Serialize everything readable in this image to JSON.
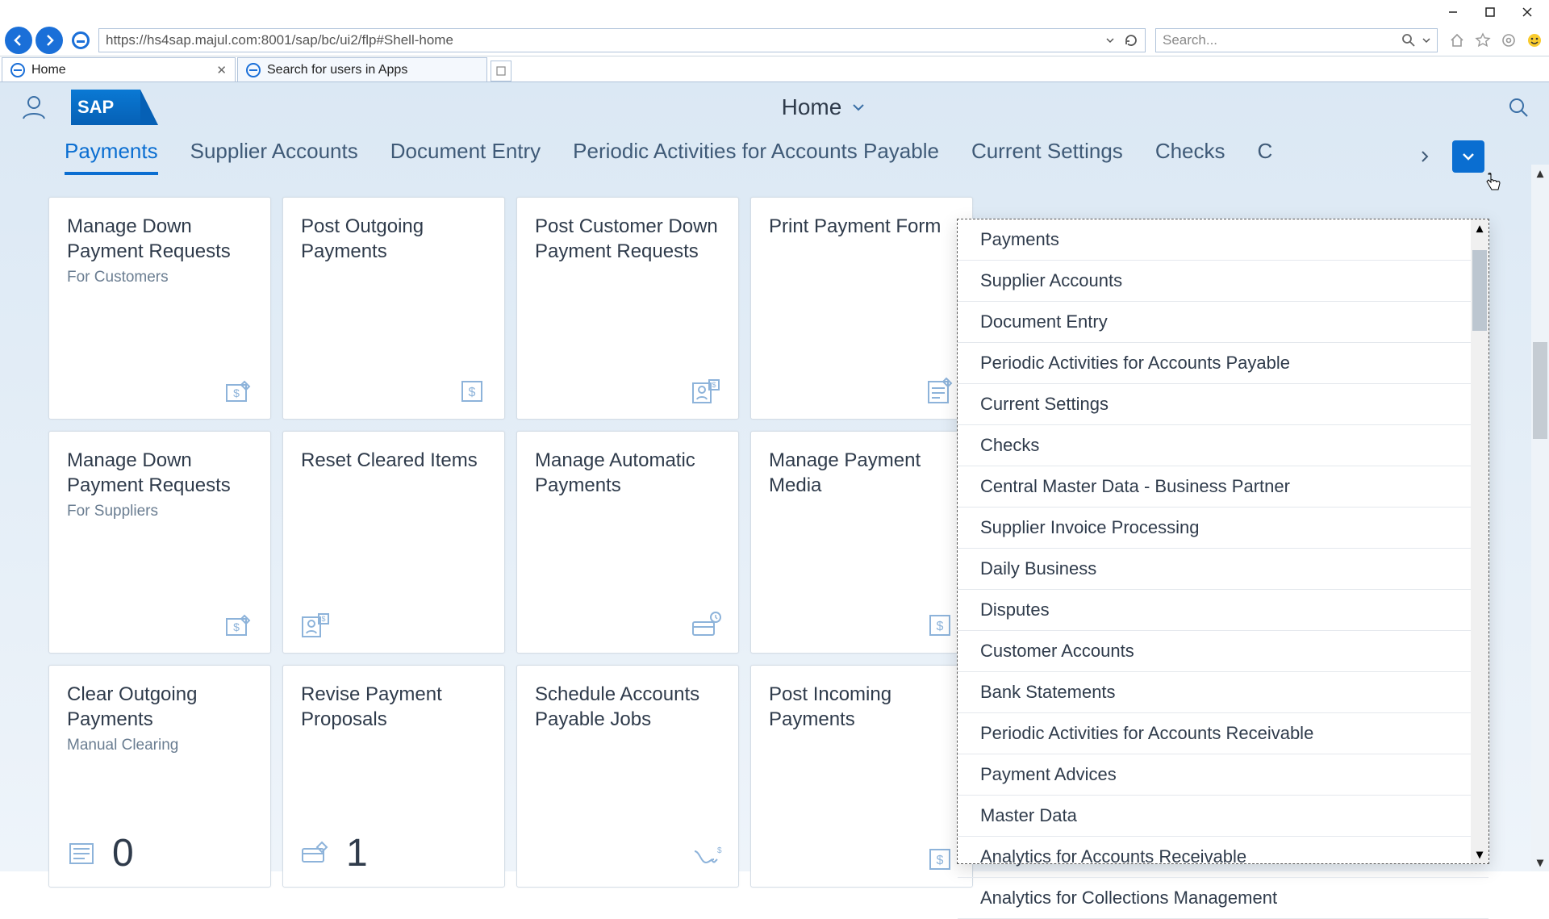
{
  "browser": {
    "url": "https://hs4sap.majul.com:8001/sap/bc/ui2/flp#Shell-home",
    "search_placeholder": "Search...",
    "tabs": [
      {
        "label": "Home",
        "active": true
      },
      {
        "label": "Search for users in Apps",
        "active": false
      }
    ]
  },
  "shell": {
    "title": "Home",
    "logo_text": "SAP"
  },
  "anchor_tabs": [
    "Payments",
    "Supplier Accounts",
    "Document Entry",
    "Periodic Activities for Accounts Payable",
    "Current Settings",
    "Checks",
    "C"
  ],
  "overflow_menu": [
    "Payments",
    "Supplier Accounts",
    "Document Entry",
    "Periodic Activities for Accounts Payable",
    "Current Settings",
    "Checks",
    "Central Master Data - Business Partner",
    "Supplier Invoice Processing",
    "Daily Business",
    "Disputes",
    "Customer Accounts",
    "Bank Statements",
    "Periodic Activities for Accounts Receivable",
    "Payment Advices",
    "Master Data",
    "Analytics for Accounts Receivable",
    "Analytics for Collections Management"
  ],
  "tiles": [
    {
      "title": "Manage Down Payment Requests",
      "sub": "For Customers",
      "icon": "money-edit",
      "align": "right"
    },
    {
      "title": "Post Outgoing Payments",
      "sub": "",
      "icon": "dollar-box",
      "align": "right"
    },
    {
      "title": "Post Customer Down Payment Requests",
      "sub": "",
      "icon": "person-money",
      "align": "right"
    },
    {
      "title": "Print Payment Form",
      "sub": "",
      "icon": "form-edit",
      "align": "right"
    },
    {
      "title": "Manage Down Payment Requests",
      "sub": "For Suppliers",
      "icon": "money-edit",
      "align": "right"
    },
    {
      "title": "Reset Cleared Items",
      "sub": "",
      "icon": "person-money",
      "align": "left"
    },
    {
      "title": "Manage Automatic Payments",
      "sub": "",
      "icon": "card-clock",
      "align": "right"
    },
    {
      "title": "Manage Payment Media",
      "sub": "",
      "icon": "dollar-box",
      "align": "right"
    },
    {
      "title": "Clear Outgoing Payments",
      "sub": "Manual Clearing",
      "icon": "list",
      "number": "0",
      "align": "right"
    },
    {
      "title": "Revise Payment Proposals",
      "sub": "",
      "icon": "card-pen",
      "number": "1",
      "align": "right"
    },
    {
      "title": "Schedule Accounts Payable Jobs",
      "sub": "",
      "icon": "chart-down",
      "align": "right"
    },
    {
      "title": "Post Incoming Payments",
      "sub": "",
      "icon": "dollar-box",
      "align": "right"
    }
  ]
}
